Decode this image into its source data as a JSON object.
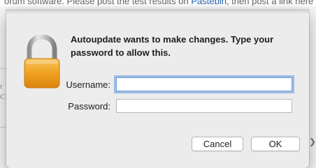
{
  "background": {
    "top_text_prefix": "orum software. Please post the test results on ",
    "top_link": "Pastebin",
    "top_text_suffix": ", then post a link here to the pa",
    "left_fragment_1": "t",
    "left_fragment_2": "C"
  },
  "dialog": {
    "message": "Autoupdate wants to make changes. Type your password to allow this.",
    "username": {
      "label": "Username:",
      "value": ""
    },
    "password": {
      "label": "Password:",
      "value": ""
    },
    "buttons": {
      "cancel": "Cancel",
      "ok": "OK"
    },
    "icon": "lock-icon"
  },
  "colors": {
    "dialog_bg": "#ececec",
    "focus_ring": "#5e96db",
    "link": "#2a67b1",
    "lock_body": "#f0a21f"
  }
}
